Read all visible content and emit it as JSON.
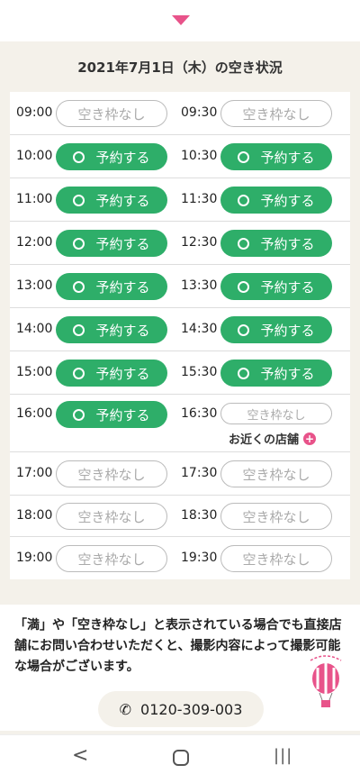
{
  "header": {
    "arrow_icon": "chevron-down-icon"
  },
  "title": "2021年7月1日（木）の空き状況",
  "labels": {
    "reserve": "予約する",
    "none": "空き枠なし",
    "nearby": "お近くの店舗",
    "plus": "+"
  },
  "slots": [
    {
      "time": "09:00",
      "status": "none"
    },
    {
      "time": "09:30",
      "status": "none"
    },
    {
      "time": "10:00",
      "status": "ok"
    },
    {
      "time": "10:30",
      "status": "ok"
    },
    {
      "time": "11:00",
      "status": "ok"
    },
    {
      "time": "11:30",
      "status": "ok"
    },
    {
      "time": "12:00",
      "status": "ok"
    },
    {
      "time": "12:30",
      "status": "ok"
    },
    {
      "time": "13:00",
      "status": "ok"
    },
    {
      "time": "13:30",
      "status": "ok"
    },
    {
      "time": "14:00",
      "status": "ok"
    },
    {
      "time": "14:30",
      "status": "ok"
    },
    {
      "time": "15:00",
      "status": "ok"
    },
    {
      "time": "15:30",
      "status": "ok"
    },
    {
      "time": "16:00",
      "status": "ok"
    },
    {
      "time": "16:30",
      "status": "none",
      "nearby": true
    },
    {
      "time": "17:00",
      "status": "none"
    },
    {
      "time": "17:30",
      "status": "none"
    },
    {
      "time": "18:00",
      "status": "none"
    },
    {
      "time": "18:30",
      "status": "none"
    },
    {
      "time": "19:00",
      "status": "none"
    },
    {
      "time": "19:30",
      "status": "none"
    }
  ],
  "notice": "「満」や「空き枠なし」と表示されている場合でも直接店舗にお問い合わせいただくと、撮影内容によって撮影可能な場合がございます。",
  "phone": {
    "number": "0120-309-003",
    "icon": "phone-icon"
  },
  "colors": {
    "accent": "#2eae69",
    "pink": "#e8538a",
    "bg": "#f4f1ea"
  }
}
